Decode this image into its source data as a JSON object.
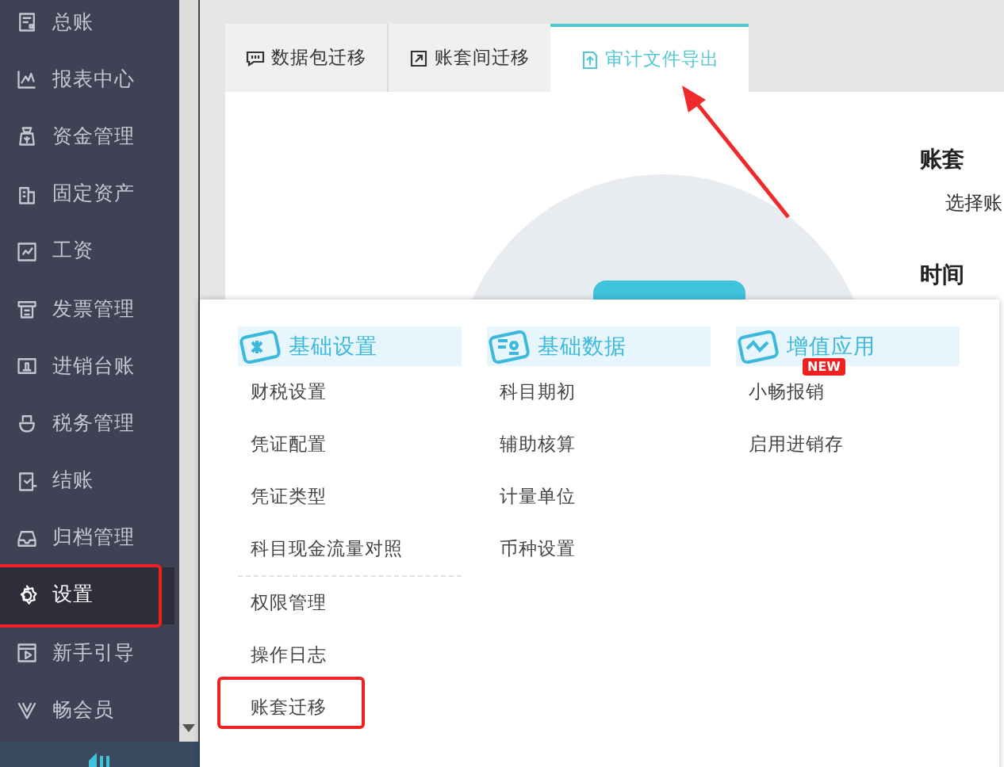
{
  "sidebar": {
    "items": [
      {
        "label": "总账",
        "selected": false,
        "annotated": false
      },
      {
        "label": "报表中心",
        "selected": false,
        "annotated": false
      },
      {
        "label": "资金管理",
        "selected": false,
        "annotated": false
      },
      {
        "label": "固定资产",
        "selected": false,
        "annotated": false
      },
      {
        "label": "工资",
        "selected": false,
        "annotated": false
      },
      {
        "label": "发票管理",
        "selected": false,
        "annotated": false
      },
      {
        "label": "进销台账",
        "selected": false,
        "annotated": false
      },
      {
        "label": "税务管理",
        "selected": false,
        "annotated": false
      },
      {
        "label": "结账",
        "selected": false,
        "annotated": false
      },
      {
        "label": "归档管理",
        "selected": false,
        "annotated": false
      },
      {
        "label": "设置",
        "selected": true,
        "annotated": true
      },
      {
        "label": "新手引导",
        "selected": false,
        "annotated": false
      },
      {
        "label": "畅会员",
        "selected": false,
        "annotated": false
      }
    ]
  },
  "tabs": [
    {
      "label": "数据包迁移",
      "selected": false
    },
    {
      "label": "账套间迁移",
      "selected": false
    },
    {
      "label": "审计文件导出",
      "selected": true
    }
  ],
  "panel": {
    "heading": "账套",
    "hint": "选择账",
    "heading_2": "时间"
  },
  "menu": {
    "columns": [
      {
        "title": "基础设置",
        "groups": [
          [
            {
              "label": "财税设置",
              "annotated": false
            },
            {
              "label": "凭证配置",
              "annotated": false
            },
            {
              "label": "凭证类型",
              "annotated": false
            },
            {
              "label": "科目现金流量对照",
              "annotated": false
            }
          ],
          [
            {
              "label": "权限管理",
              "annotated": false
            },
            {
              "label": "操作日志",
              "annotated": false
            },
            {
              "label": "账套迁移",
              "annotated": true
            }
          ]
        ]
      },
      {
        "title": "基础数据",
        "groups": [
          [
            {
              "label": "科目期初",
              "annotated": false
            },
            {
              "label": "辅助核算",
              "annotated": false
            },
            {
              "label": "计量单位",
              "annotated": false
            },
            {
              "label": "币种设置",
              "annotated": false
            }
          ]
        ]
      },
      {
        "title": "增值应用",
        "groups": [
          [
            {
              "label": "小畅报销",
              "badge": "NEW",
              "annotated": false
            },
            {
              "label": "启用进销存",
              "annotated": false
            }
          ]
        ]
      }
    ]
  }
}
